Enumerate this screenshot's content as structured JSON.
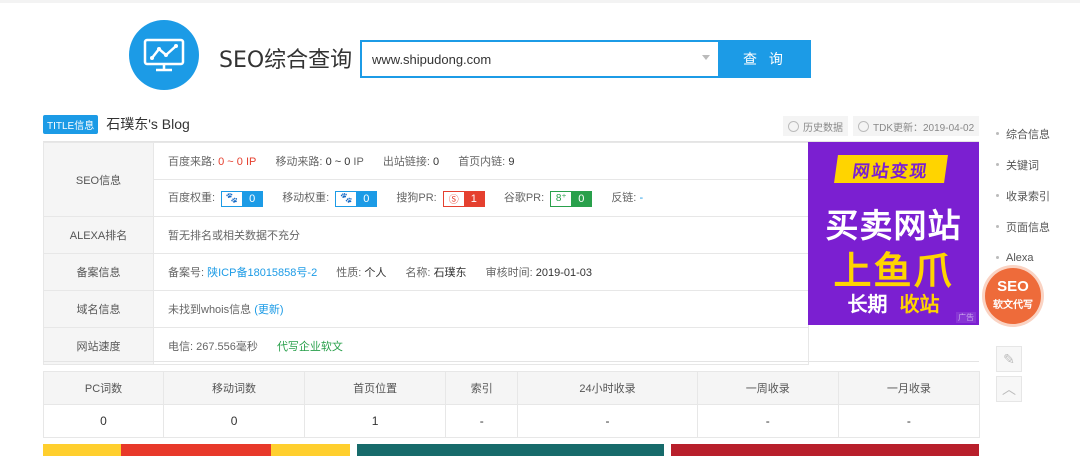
{
  "header": {
    "title": "SEO综合查询",
    "search_value": "www.shipudong.com",
    "search_button": "查 询"
  },
  "site": {
    "badge": "TITLE信息",
    "title": "石璞东's Blog",
    "history_btn": "历史数据",
    "tdk_btn": "TDK更新：2019-04-02"
  },
  "seo": {
    "label": "SEO信息",
    "baidu_traffic_label": "百度来路:",
    "baidu_traffic": "0 ~ 0",
    "mobile_traffic_label": "移动来路:",
    "mobile_traffic": "0 ~ 0",
    "ip_unit": "IP",
    "outlinks_label": "出站链接:",
    "outlinks": "0",
    "inlinks_label": "首页内链:",
    "inlinks": "9",
    "baidu_weight_label": "百度权重:",
    "baidu_weight": "0",
    "mobile_weight_label": "移动权重:",
    "mobile_weight": "0",
    "sogou_pr_label": "搜狗PR:",
    "sogou_pr": "1",
    "google_pr_label": "谷歌PR:",
    "google_pr": "0",
    "backlinks_label": "反链:",
    "backlinks": "-"
  },
  "alexa": {
    "label": "ALEXA排名",
    "value": "暂无排名或相关数据不充分"
  },
  "icp": {
    "label": "备案信息",
    "no_label": "备案号:",
    "no": "陕ICP备18015858号-2",
    "type_label": "性质:",
    "type": "个人",
    "name_label": "名称:",
    "name": "石璞东",
    "time_label": "审核时间:",
    "time": "2019-01-03"
  },
  "domain": {
    "label": "域名信息",
    "value": "未找到whois信息",
    "update": "(更新)"
  },
  "speed": {
    "label": "网站速度",
    "value": "电信: 267.556毫秒",
    "link": "代写企业软文"
  },
  "ad": {
    "line1": "网站变现",
    "line2": "买卖网站",
    "line3": "上鱼爪",
    "line4a": "长期",
    "line4b": "收站",
    "tag": "广告"
  },
  "stats": {
    "headers": [
      "PC词数",
      "移动词数",
      "首页位置",
      "索引",
      "24小时收录",
      "一周收录",
      "一月收录"
    ],
    "values": [
      "0",
      "0",
      "1",
      "-",
      "-",
      "-",
      "-"
    ]
  },
  "sidenav": [
    "综合信息",
    "关键词",
    "收录索引",
    "页面信息",
    "Alexa"
  ],
  "float": {
    "line1": "SEO",
    "line2": "软文代写"
  },
  "colors": {
    "primary": "#1c9be6",
    "red": "#e5402f",
    "green": "#29a04b",
    "ad_purple": "#7b1fd1",
    "ad_yellow": "#ffd400"
  }
}
